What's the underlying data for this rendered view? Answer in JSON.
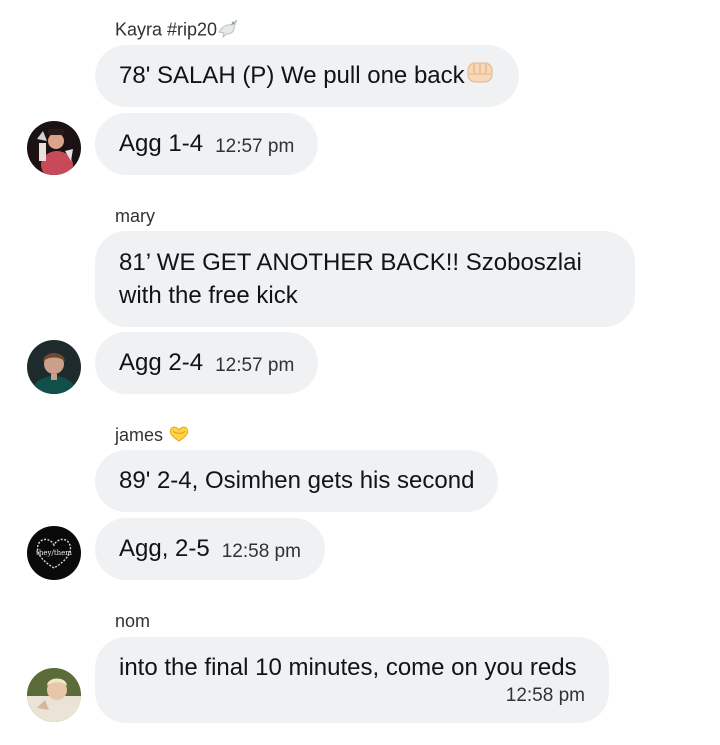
{
  "messages": [
    {
      "sender": "Kayra #rip20",
      "sender_emoji": "dove-icon",
      "bubbles": [
        {
          "text": "78' SALAH (P) We pull one back",
          "emoji": "fist-icon"
        },
        {
          "text": "Agg 1-4",
          "time": "12:57 pm"
        }
      ]
    },
    {
      "sender": "mary",
      "bubbles": [
        {
          "text": "81’ WE GET ANOTHER BACK!! Szoboszlai with the free kick"
        },
        {
          "text": "Agg 2-4",
          "time": "12:57 pm"
        }
      ]
    },
    {
      "sender": "james",
      "sender_emoji": "heart-hands-icon",
      "bubbles": [
        {
          "text": "89' 2-4, Osimhen gets his second"
        },
        {
          "text": "Agg, 2-5",
          "time": "12:58 pm"
        }
      ]
    },
    {
      "sender": "nom",
      "bubbles": [
        {
          "text": "into the final 10 minutes, come on you reds",
          "time": "12:58 pm"
        }
      ]
    }
  ],
  "avatars": {
    "james_logo_text": "they/them"
  },
  "colors": {
    "bubble_bg": "#eff1f3",
    "text": "#0f1419",
    "secondary_text": "#2f3336"
  }
}
